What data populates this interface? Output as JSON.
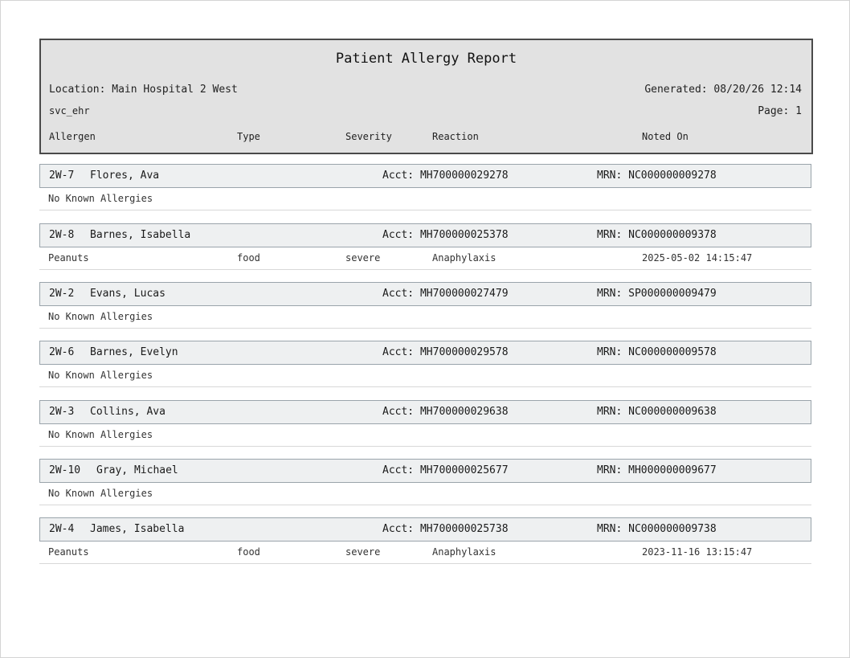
{
  "report": {
    "title": "Patient Allergy Report",
    "location": "Location: Main Hospital 2 West",
    "generated": "Generated: 08/20/26 12:14",
    "user": "svc_ehr",
    "page": "Page: 1",
    "columns": {
      "allergen": "Allergen",
      "type": "Type",
      "severity": "Severity",
      "reaction": "Reaction",
      "noted_on": "Noted On"
    }
  },
  "patients": [
    {
      "bed": "2W-7",
      "name": "Flores, Ava",
      "acct": "Acct: MH700000029278",
      "mrn": "MRN: NC000000009278",
      "no_allergies": "No Known Allergies"
    },
    {
      "bed": "2W-8",
      "name": "Barnes, Isabella",
      "acct": "Acct: MH700000025378",
      "mrn": "MRN: NC000000009378",
      "allergy": {
        "allergen": "Peanuts",
        "type": "food",
        "severity": "severe",
        "reaction": "Anaphylaxis",
        "noted_on": "2025-05-02 14:15:47"
      }
    },
    {
      "bed": "2W-2",
      "name": "Evans, Lucas",
      "acct": "Acct: MH700000027479",
      "mrn": "MRN: SP000000009479",
      "no_allergies": "No Known Allergies"
    },
    {
      "bed": "2W-6",
      "name": "Barnes, Evelyn",
      "acct": "Acct: MH700000029578",
      "mrn": "MRN: NC000000009578",
      "no_allergies": "No Known Allergies"
    },
    {
      "bed": "2W-3",
      "name": "Collins, Ava",
      "acct": "Acct: MH700000029638",
      "mrn": "MRN: NC000000009638",
      "no_allergies": "No Known Allergies"
    },
    {
      "bed": "2W-10",
      "name": "Gray, Michael",
      "acct": "Acct: MH700000025677",
      "mrn": "MRN: MH000000009677",
      "no_allergies": "No Known Allergies"
    },
    {
      "bed": "2W-4",
      "name": "James, Isabella",
      "acct": "Acct: MH700000025738",
      "mrn": "MRN: NC000000009738",
      "allergy": {
        "allergen": "Peanuts",
        "type": "food",
        "severity": "severe",
        "reaction": "Anaphylaxis",
        "noted_on": "2023-11-16 13:15:47"
      }
    }
  ]
}
